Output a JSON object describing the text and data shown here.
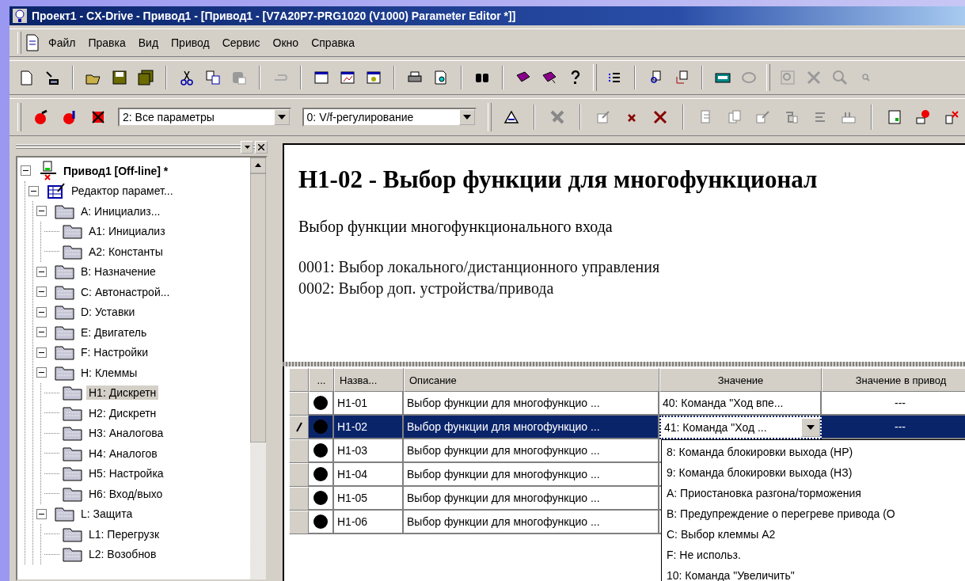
{
  "window": {
    "title": "Проект1 - CX-Drive - Привод1 - [Привод1 - [V7A20P7-PRG1020 (V1000) Parameter Editor *]]"
  },
  "menu": [
    "Файл",
    "Правка",
    "Вид",
    "Привод",
    "Сервис",
    "Окно",
    "Справка"
  ],
  "filters": [
    {
      "value": "2: Все параметры"
    },
    {
      "value": "0: V/f-регулирование"
    }
  ],
  "tree": [
    {
      "label": "Привод1 [Off-line] *",
      "kind": "drive",
      "expanded": true,
      "selected": false,
      "children": [
        {
          "label": "Редактор парамет...",
          "kind": "editor",
          "expanded": true,
          "selected": false,
          "children": [
            {
              "label": "A: Инициализ...",
              "kind": "folder",
              "expanded": true,
              "selected": false,
              "children": [
                {
                  "label": "A1: Инициализ",
                  "kind": "folder",
                  "selected": false
                },
                {
                  "label": "A2: Константы",
                  "kind": "folder",
                  "selected": false
                }
              ]
            },
            {
              "label": "B: Назначение",
              "kind": "folder",
              "expanded": true,
              "selected": false
            },
            {
              "label": "C: Автонастрой...",
              "kind": "folder",
              "expanded": true,
              "selected": false
            },
            {
              "label": "D: Уставки",
              "kind": "folder",
              "expanded": true,
              "selected": false
            },
            {
              "label": "E: Двигатель",
              "kind": "folder",
              "expanded": true,
              "selected": false
            },
            {
              "label": "F: Настройки",
              "kind": "folder",
              "expanded": true,
              "selected": false
            },
            {
              "label": "H: Клеммы",
              "kind": "folder",
              "expanded": true,
              "selected": false,
              "children": [
                {
                  "label": "H1: Дискретн",
                  "kind": "folder",
                  "selected": true
                },
                {
                  "label": "H2: Дискретн",
                  "kind": "folder",
                  "selected": false
                },
                {
                  "label": "H3: Аналогова",
                  "kind": "folder",
                  "selected": false
                },
                {
                  "label": "H4: Аналогов",
                  "kind": "folder",
                  "selected": false
                },
                {
                  "label": "H5: Настройка",
                  "kind": "folder",
                  "selected": false
                },
                {
                  "label": "H6: Вход/выхо",
                  "kind": "folder",
                  "selected": false
                }
              ]
            },
            {
              "label": "L: Защита",
              "kind": "folder",
              "expanded": true,
              "selected": false,
              "children": [
                {
                  "label": "L1: Перегрузк",
                  "kind": "folder",
                  "selected": false
                },
                {
                  "label": "L2: Возобнов",
                  "kind": "folder",
                  "selected": false
                }
              ]
            }
          ]
        }
      ]
    }
  ],
  "doc": {
    "heading": "H1-02 - Выбор функции для многофункционал",
    "intro": "Выбор функции многофункционального входа",
    "lines": [
      "0001: Выбор локального/дистанционного управления",
      "0002: Выбор доп. устройства/привода"
    ]
  },
  "grid": {
    "columns": [
      "...",
      "Назва...",
      "Описание",
      "Значение",
      "Значение в привод"
    ],
    "rows": [
      {
        "name": "H1-01",
        "description": "Выбор функции для многофункцио ...",
        "value": "40: Команда \"Ход впе...",
        "drive_value": "---",
        "selected": false,
        "editing": false
      },
      {
        "name": "H1-02",
        "description": "Выбор функции для многофункцио ...",
        "value": "41: Команда \"Ход ...",
        "drive_value": "---",
        "selected": true,
        "editing": true
      },
      {
        "name": "H1-03",
        "description": "Выбор функции для многофункцио ...",
        "selected": false,
        "editing": false
      },
      {
        "name": "H1-04",
        "description": "Выбор функции для многофункцио ...",
        "selected": false,
        "editing": false
      },
      {
        "name": "H1-05",
        "description": "Выбор функции для многофункцио ...",
        "selected": false,
        "editing": false
      },
      {
        "name": "H1-06",
        "description": "Выбор функции для многофункцио ...",
        "selected": false,
        "editing": false
      }
    ]
  },
  "dropdown": {
    "items": [
      "8: Команда блокировки выхода (НР)",
      "9: Команда блокировки выхода (НЗ)",
      "A: Приостановка разгона/торможения",
      "B: Предупреждение о перегреве привода (О",
      "C: Выбор клеммы A2",
      "F: Не использ.",
      "10: Команда \"Увеличить\""
    ]
  }
}
